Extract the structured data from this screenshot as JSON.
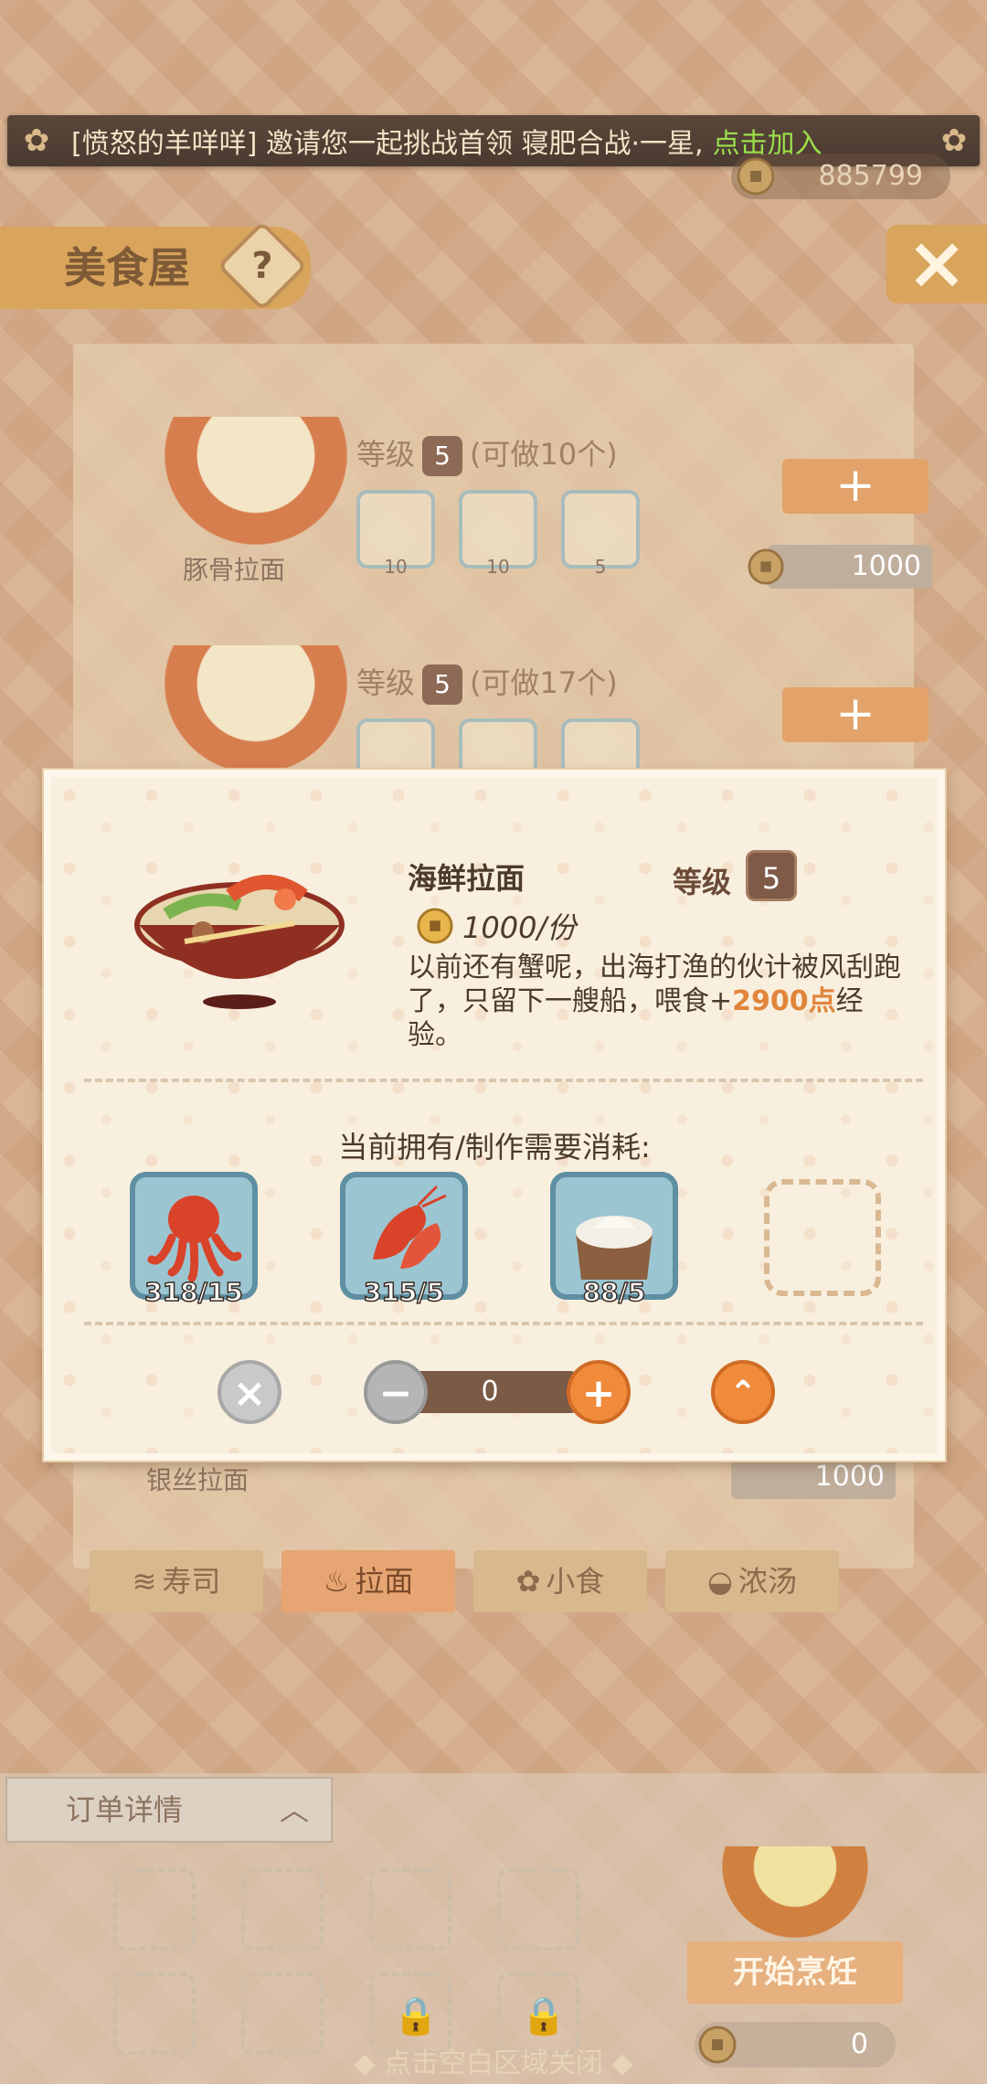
{
  "banner": {
    "message": "[愤怒的羊咩咩] 邀请您一起挑战首领 寝肥合战·一星,",
    "join_label": "点击加入"
  },
  "currency": {
    "top_coins": "885799"
  },
  "header": {
    "title": "美食屋",
    "help_icon": "?",
    "close_icon": "×"
  },
  "recipe_list": [
    {
      "name": "豚骨拉面",
      "level_label": "等级",
      "level": "5",
      "makeable": "(可做10个)",
      "ingredient_counts": [
        "10",
        "10",
        "5"
      ],
      "cost": "1000"
    },
    {
      "name": "",
      "level_label": "等级",
      "level": "5",
      "makeable": "(可做17个)",
      "ingredient_counts": [
        "",
        "",
        ""
      ],
      "cost": ""
    },
    {
      "name": "银丝拉面",
      "level_label": "",
      "level": "",
      "makeable": "",
      "ingredient_counts": [],
      "cost": "1000"
    }
  ],
  "categories": [
    {
      "label": "寿司",
      "icon": "sushi-icon",
      "active": false
    },
    {
      "label": "拉面",
      "icon": "ramen-icon",
      "active": true
    },
    {
      "label": "小食",
      "icon": "snack-icon",
      "active": false
    },
    {
      "label": "浓汤",
      "icon": "soup-icon",
      "active": false
    }
  ],
  "order": {
    "title": "订单详情",
    "start_label": "开始烹饪",
    "start_cost": "0",
    "hint": "◆ 点击空白区域关闭 ◆"
  },
  "modal": {
    "dish_name": "海鲜拉面",
    "level_label": "等级",
    "level": "5",
    "price": "1000/份",
    "desc_before": "以前还有蟹呢，出海打渔的伙计被风刮跑了，只留下一艘船，喂食+",
    "desc_exp": "2900点",
    "desc_after": "经验。",
    "need_label": "当前拥有/制作需要消耗:",
    "ingredients": [
      {
        "icon": "octopus-icon",
        "count": "318/15"
      },
      {
        "icon": "shrimp-icon",
        "count": "315/5"
      },
      {
        "icon": "flour-sack-icon",
        "count": "88/5"
      }
    ],
    "quantity": "0"
  },
  "colors": {
    "accent": "#f08b3c",
    "exp": "#e1853b",
    "join": "#9be04b"
  }
}
